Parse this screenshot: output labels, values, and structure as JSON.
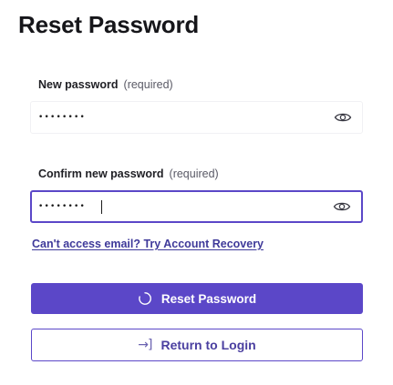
{
  "page": {
    "title": "Reset Password"
  },
  "form": {
    "new_password": {
      "label": "New password",
      "required_text": "(required)",
      "value": "••••••••",
      "toggle_icon": "eye-icon"
    },
    "confirm_password": {
      "label": "Confirm new password",
      "required_text": "(required)",
      "value": "••••••••",
      "toggle_icon": "eye-icon"
    },
    "recovery_link": "Can't access email? Try Account Recovery",
    "submit": {
      "label": "Reset Password",
      "icon": "spinner-icon"
    },
    "return": {
      "label": "Return to Login",
      "icon": "login-icon",
      "icon_glyph": "→]"
    }
  },
  "colors": {
    "accent": "#5b47c8",
    "link": "#3f3a9a",
    "text": "#1b1b1f"
  }
}
